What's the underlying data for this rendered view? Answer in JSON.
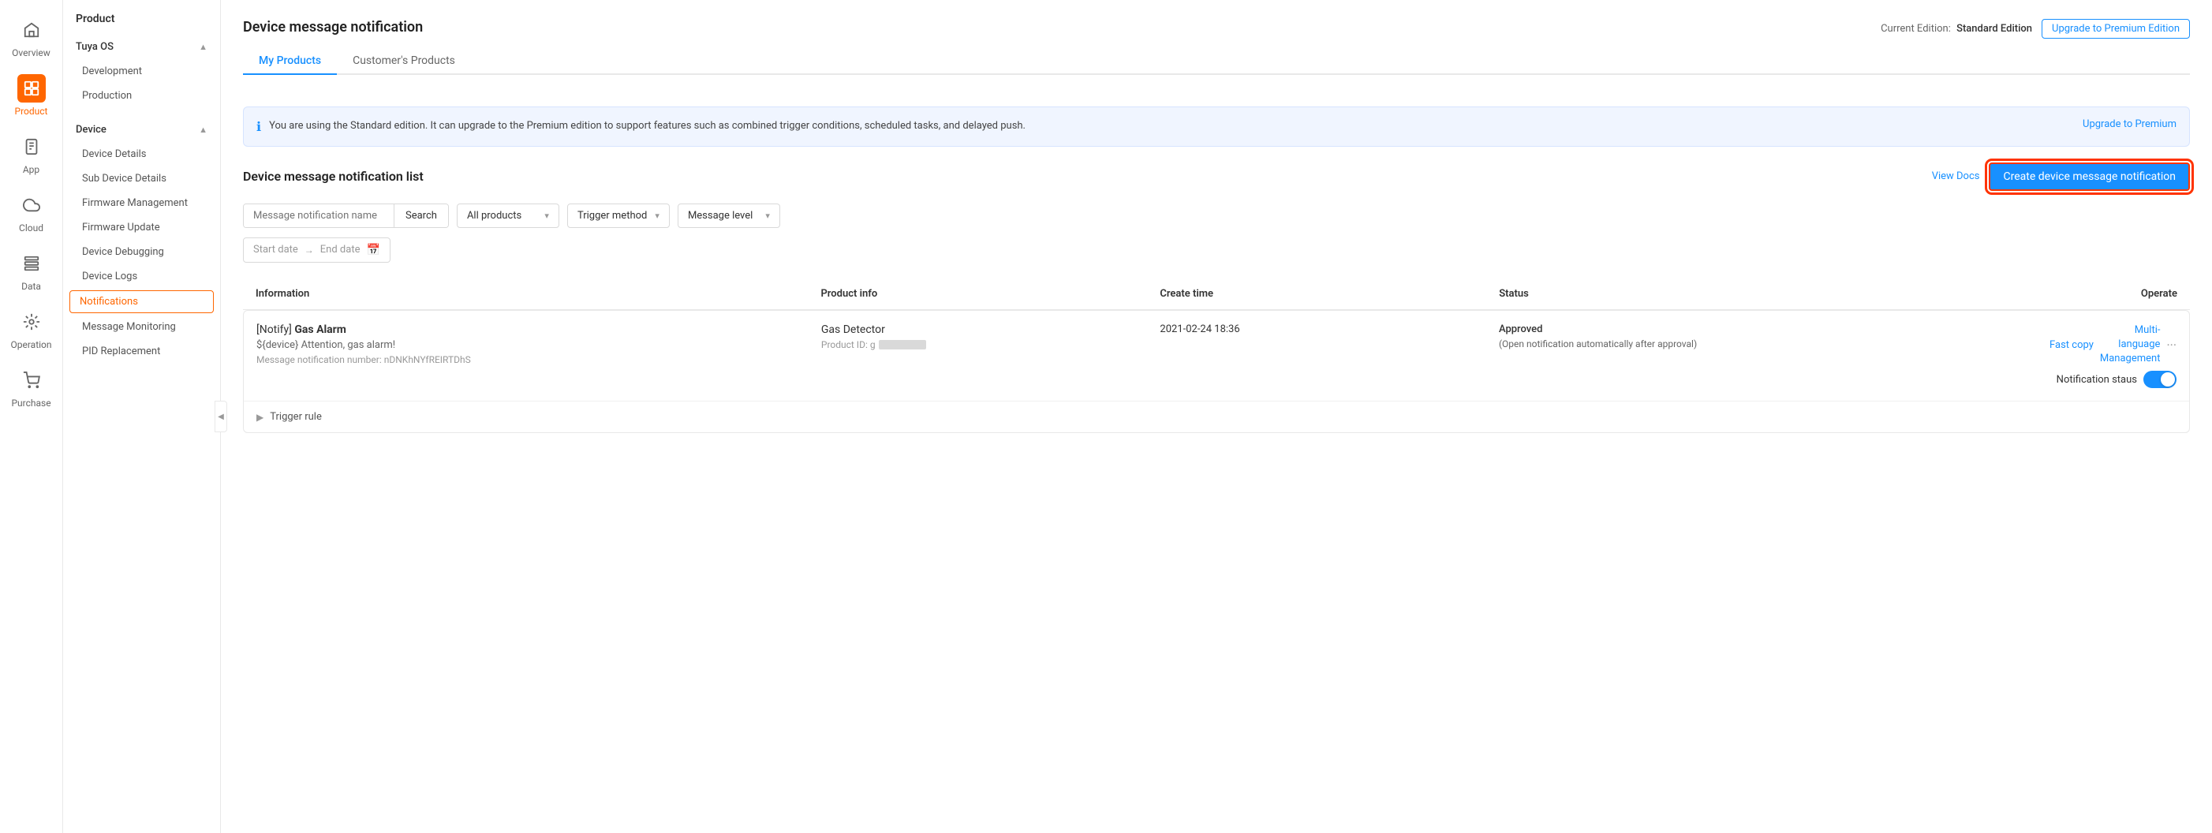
{
  "sidebar": {
    "items": [
      {
        "id": "overview",
        "label": "Overview",
        "icon": "home"
      },
      {
        "id": "product",
        "label": "Product",
        "icon": "product",
        "active": true
      },
      {
        "id": "app",
        "label": "App",
        "icon": "app"
      },
      {
        "id": "cloud",
        "label": "Cloud",
        "icon": "cloud"
      },
      {
        "id": "data",
        "label": "Data",
        "icon": "data"
      },
      {
        "id": "operation",
        "label": "Operation",
        "icon": "operation"
      },
      {
        "id": "purchase",
        "label": "Purchase",
        "icon": "purchase"
      }
    ]
  },
  "nav_panel": {
    "title": "Product",
    "groups": [
      {
        "label": "Tuya OS",
        "expanded": true,
        "items": [
          {
            "label": "Development",
            "active": false
          },
          {
            "label": "Production",
            "active": false
          }
        ]
      },
      {
        "label": "Device",
        "expanded": true,
        "items": [
          {
            "label": "Device Details",
            "active": false
          },
          {
            "label": "Sub Device Details",
            "active": false
          },
          {
            "label": "Firmware Management",
            "active": false
          },
          {
            "label": "Firmware Update",
            "active": false
          },
          {
            "label": "Device Debugging",
            "active": false
          },
          {
            "label": "Device Logs",
            "active": false
          },
          {
            "label": "Notifications",
            "active": true,
            "highlighted": true
          },
          {
            "label": "Message Monitoring",
            "active": false
          },
          {
            "label": "PID Replacement",
            "active": false
          }
        ]
      }
    ]
  },
  "page": {
    "title": "Device message notification",
    "tabs": [
      {
        "label": "My Products",
        "active": true
      },
      {
        "label": "Customer's Products",
        "active": false
      }
    ],
    "edition": {
      "current_label": "Current Edition:",
      "edition_name": "Standard Edition",
      "upgrade_btn": "Upgrade to Premium Edition"
    },
    "info_banner": {
      "text": "You are using the Standard edition. It can upgrade to the Premium edition to support features such as combined trigger conditions, scheduled tasks, and delayed push.",
      "link": "Upgrade to Premium"
    },
    "list_section": {
      "title": "Device message notification list",
      "view_docs": "View Docs",
      "create_btn": "Create device message notification"
    },
    "filters": {
      "name_placeholder": "Message notification name",
      "search_btn": "Search",
      "product_dropdown": "All products",
      "trigger_dropdown": "Trigger method",
      "level_dropdown": "Message level",
      "date_start": "Start date",
      "date_arrow": "→",
      "date_end": "End date"
    },
    "table": {
      "headers": [
        "Information",
        "Product info",
        "Create time",
        "Status",
        "Operate"
      ],
      "rows": [
        {
          "notify_tag": "[Notify]",
          "notify_name": "Gas Alarm",
          "notify_template": "${device} Attention, gas alarm!",
          "notify_num_label": "Message notification number:",
          "notify_num": "nDNKhNYfREIRTDhS",
          "product_name": "Gas Detector",
          "product_id_label": "Product ID: g",
          "create_time": "2021-02-24 18:36",
          "status": "Approved",
          "status_sub": "(Open notification automatically after approval)",
          "op_fast_copy": "Fast copy",
          "op_multi_lang": "Multi-language Management",
          "toggle_label": "Notification staus",
          "toggle_on": true,
          "trigger_rule": "Trigger rule"
        }
      ]
    }
  }
}
